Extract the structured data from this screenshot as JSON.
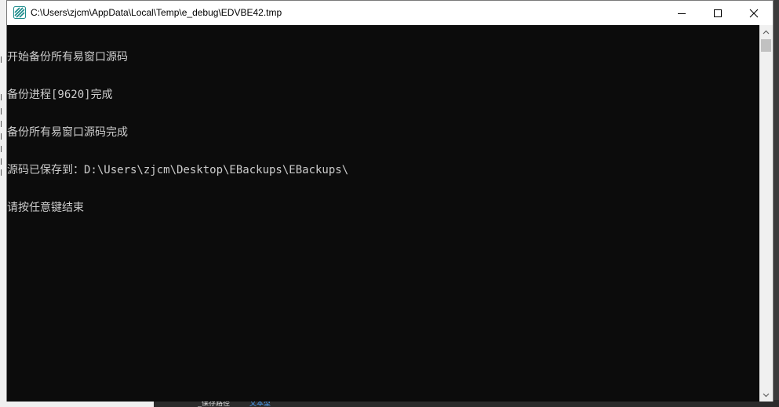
{
  "window": {
    "title": "C:\\Users\\zjcm\\AppData\\Local\\Temp\\e_debug\\EDVBE42.tmp",
    "icon": "console-app-icon"
  },
  "controls": {
    "minimize_icon": "minimize-icon",
    "maximize_icon": "maximize-icon",
    "close_icon": "close-icon"
  },
  "console": {
    "lines": [
      "开始备份所有易窗口源码",
      "备份进程[9620]完成",
      "备份所有易窗口源码完成",
      "源码已保存到：D:\\Users\\zjcm\\Desktop\\EBackups\\EBackups\\",
      "请按任意键结束"
    ],
    "background": "#0c0c0c",
    "foreground": "#cccccc"
  },
  "background_app": {
    "tabs": [
      "_保存路径",
      "文本型"
    ]
  }
}
